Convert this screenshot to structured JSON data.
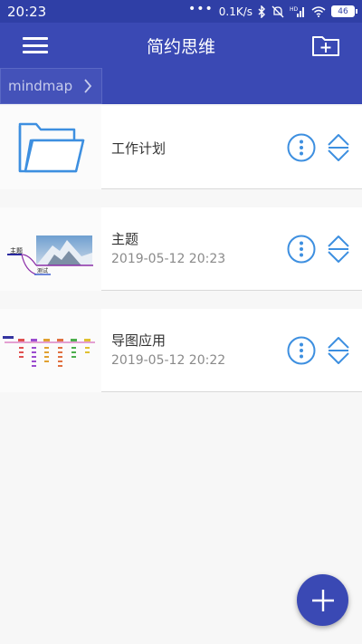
{
  "status_bar": {
    "time": "20:23",
    "dots": "•••",
    "network_speed": "0.1K/s",
    "battery": "46",
    "icons": [
      "bluetooth-icon",
      "mute-icon",
      "signal-icon",
      "wifi-icon",
      "battery-icon"
    ]
  },
  "app_bar": {
    "title": "简约思维",
    "menu_icon": "hamburger-menu-icon",
    "action_icon": "new-folder-icon"
  },
  "breadcrumb": {
    "items": [
      "mindmap"
    ],
    "separator_icon": "chevron-right-icon"
  },
  "list": {
    "items": [
      {
        "type": "folder",
        "title": "工作计划",
        "date": ""
      },
      {
        "type": "mindmap",
        "title": "主题",
        "date": "2019-05-12 20:23",
        "thumb_labels": [
          "主题",
          "测试"
        ]
      },
      {
        "type": "mindmap",
        "title": "导图应用",
        "date": "2019-05-12 20:22"
      }
    ],
    "more_icon": "more-vertical-icon",
    "sort_icon": "reorder-arrows-icon"
  },
  "fab": {
    "icon": "plus-icon"
  },
  "colors": {
    "status_bar": "#2f3fa6",
    "primary": "#3a49b4",
    "accent_icon": "#3d8fe0",
    "background": "#f7f7f7"
  }
}
